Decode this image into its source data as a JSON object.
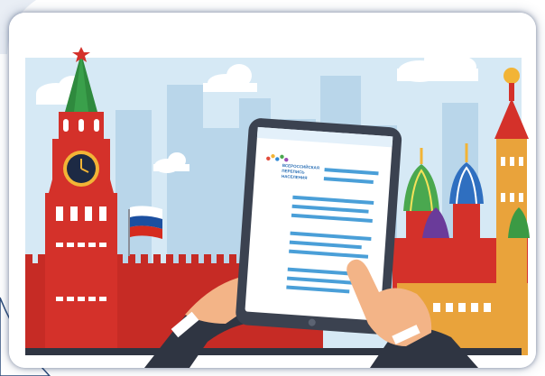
{
  "illustration": {
    "subject": "tablet-survey-moscow",
    "tablet_logo_lines": [
      "ВСЕРОССИЙСКАЯ",
      "ПЕРЕПИСЬ",
      "НАСЕЛЕНИЯ"
    ]
  },
  "colors": {
    "sky": "#cfe5f3",
    "tower_red": "#d4312a",
    "wall_red": "#c62b25",
    "flag_white": "#ffffff",
    "flag_blue": "#1c4fa0",
    "flag_red": "#d52b1e",
    "tablet_frame": "#3b4250",
    "screen": "#ffffff",
    "doc_lines": "#4a9fd8"
  }
}
